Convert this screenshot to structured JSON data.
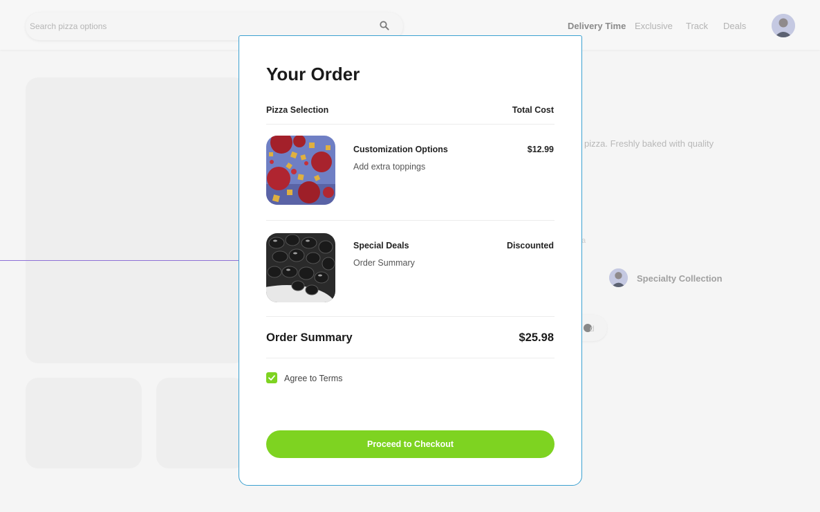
{
  "header": {
    "search_placeholder": "Search pizza options",
    "nav": [
      "Delivery Time",
      "Exclusive",
      "Track",
      "Deals"
    ]
  },
  "background": {
    "description_fragment": "pizza. Freshly baked with quality",
    "small_fragment": "a",
    "author_name": "Specialty Collection",
    "chip_text": "d"
  },
  "modal": {
    "title": "Your Order",
    "col_left": "Pizza Selection",
    "col_right": "Total Cost",
    "items": [
      {
        "name": "Customization Options",
        "sub": "Add extra toppings",
        "price": "$12.99",
        "image": "pepperoni-cheese-image"
      },
      {
        "name": "Special Deals",
        "sub": "Order Summary",
        "price": "Discounted",
        "image": "black-olives-image"
      }
    ],
    "summary_label": "Order Summary",
    "summary_total": "$25.98",
    "terms_label": "Agree to Terms",
    "terms_checked": true,
    "checkout_label": "Proceed to Checkout"
  },
  "colors": {
    "accent": "#7ed321",
    "modal_border": "#3aa0d0",
    "purple_guide": "#8d6fd6"
  }
}
